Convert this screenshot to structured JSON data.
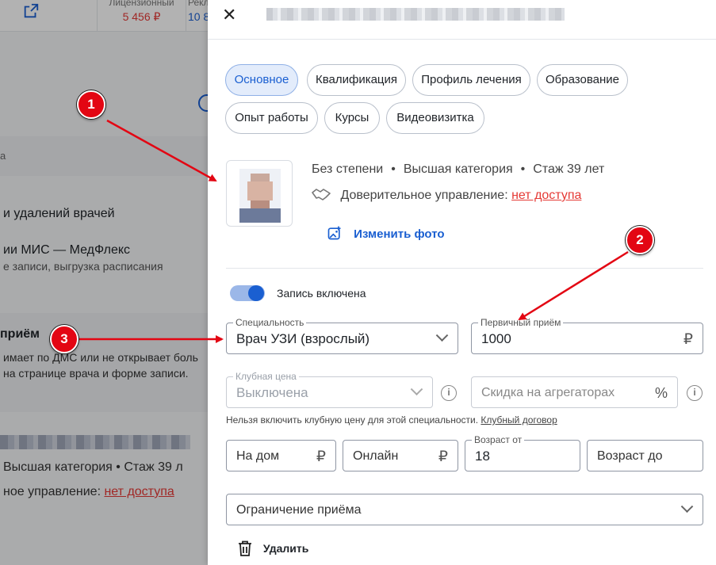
{
  "background": {
    "license_label": "Лицензионный",
    "license_value": "5 456 ₽",
    "ads_label": "Рекл",
    "ads_value": "10 8",
    "section_label": "а",
    "line1": "и удалений врачей",
    "line2": "ии МИС — МедФлекс",
    "line3": "е записи, выгрузка расписания",
    "reception_title": "приём",
    "reception_line1": "имает по ДМС или не открывает боль",
    "reception_line2": "на странице врача и форме записи.",
    "category_line": "Высшая категория  •  Стаж 39 л",
    "trust_prefix": "ное управление: ",
    "trust_link": "нет доступа"
  },
  "drawer": {
    "tabs": [
      "Основное",
      "Квалификация",
      "Профиль лечения",
      "Образование",
      "Опыт работы",
      "Курсы",
      "Видеовизитка"
    ],
    "active_tab": "Основное",
    "degree": "Без степени",
    "category": "Высшая категория",
    "experience": "Стаж 39 лет",
    "trust_label": "Доверительное управление:",
    "trust_link": "нет доступа",
    "change_photo": "Изменить фото",
    "booking_toggle_label": "Запись включена",
    "booking_enabled": true,
    "specialty_label": "Специальность",
    "specialty_value": "Врач УЗИ (взрослый)",
    "primary_label": "Первичный приём",
    "primary_value": "1000",
    "currency": "₽",
    "club_label": "Клубная цена",
    "club_value": "Выключена",
    "discount_placeholder": "Скидка на агрегаторах",
    "percent": "%",
    "hint_text": "Нельзя включить клубную цену для этой специальности. ",
    "hint_link": "Клубный договор",
    "home_placeholder": "На дом",
    "online_placeholder": "Онлайн",
    "age_from_label": "Возраст от",
    "age_from_value": "18",
    "age_to_placeholder": "Возраст до",
    "restriction_placeholder": "Ограничение приёма",
    "delete_label": "Удалить"
  },
  "annotations": [
    "1",
    "2",
    "3"
  ],
  "colors": {
    "accent": "#1a5fd1",
    "danger": "#e53935",
    "badge": "#e30613"
  }
}
